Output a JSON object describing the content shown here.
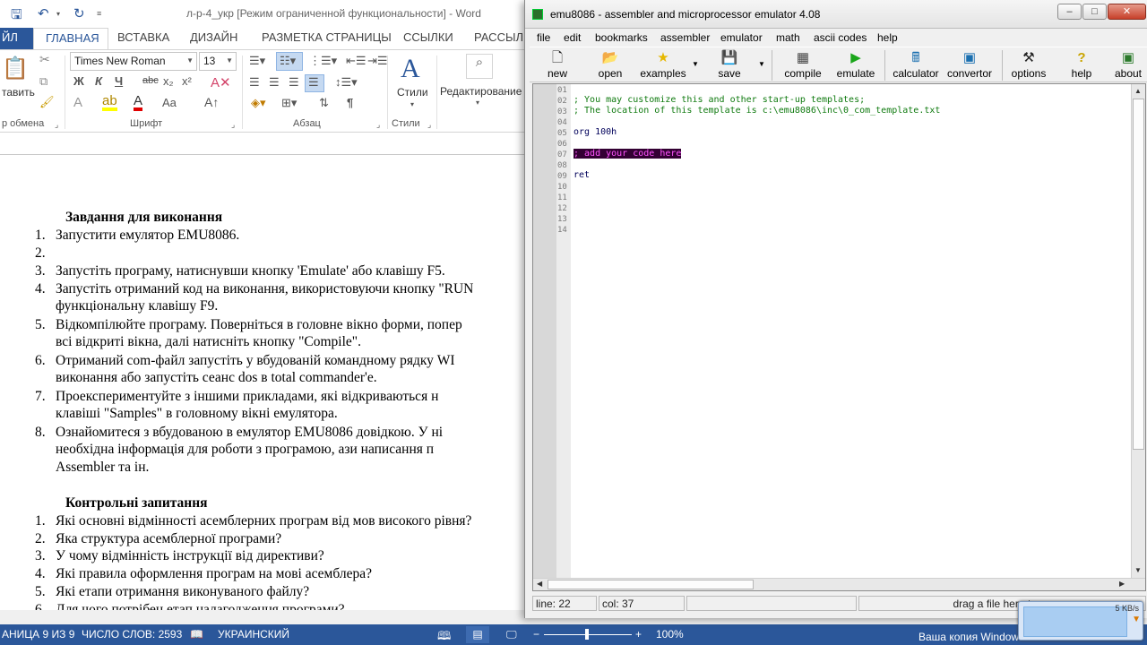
{
  "word": {
    "title": "л-р-4_укр [Режим ограниченной функциональности] - Word",
    "tabs": [
      "ЙЛ",
      "ГЛАВНАЯ",
      "ВСТАВКА",
      "ДИЗАЙН",
      "РАЗМЕТКА СТРАНИЦЫ",
      "ССЫЛКИ",
      "РАССЫЛК"
    ],
    "ribbon": {
      "paste_label": "тавить",
      "clipboard_label": "р обмена",
      "font_name": "Times New Roman",
      "font_size": "13",
      "font_group": "Шрифт",
      "paragraph_group": "Абзац",
      "styles_button": "Стили",
      "styles_group": "Стили",
      "editing_button": "Редактирование",
      "bold": "Ж",
      "italic": "К",
      "underline": "Ч",
      "strike": "abc",
      "subscript": "x₂",
      "superscript": "x²",
      "case": "Aa"
    },
    "doc": {
      "heading1": "Завдання для виконання",
      "tasks": [
        {
          "n": "1.",
          "lines": [
            "Запустити емулятор EMU8086."
          ]
        },
        {
          "n": "2.",
          "lines": [
            ""
          ]
        },
        {
          "n": "3.",
          "lines": [
            "Запустіть програму, натиснувши кнопку 'Emulate' або клавішу F5."
          ]
        },
        {
          "n": "4.",
          "lines": [
            "Запустіть отриманий код на виконання, використовуючи кнопку \"RUN",
            "функціональну клавішу F9."
          ]
        },
        {
          "n": "5.",
          "lines": [
            "Відкомпілюйте програму. Поверніться в головне вікно форми, попер",
            "всі відкриті вікна, далі натисніть кнопку \"Compile\"."
          ]
        },
        {
          "n": "6.",
          "lines": [
            "Отриманий com-файл запустіть у вбудованій командному рядку WI",
            "виконання або запустіть сеанс dos в total commander'е."
          ]
        },
        {
          "n": "7.",
          "lines": [
            "Проекспериментуйте з іншими прикладами, які відкриваються н",
            "клавіші \"Samples\" в головному вікні емулятора."
          ]
        },
        {
          "n": "8.",
          "lines": [
            "Ознайомитеся з вбудованою в емулятор EMU8086 довідкою. У ні",
            "необхідна інформація для роботи з програмою, ази написання п",
            "Assembler та ін."
          ]
        }
      ],
      "heading2": "Контрольні запитання",
      "questions": [
        {
          "n": "1.",
          "text": "Які основні відмінності асемблерних програм від мов високого рівня?"
        },
        {
          "n": "2.",
          "text": "Яка структура асемблерної програми?"
        },
        {
          "n": "3.",
          "text": "У чому відмінність інструкції від директиви?"
        },
        {
          "n": "4.",
          "text": "Які правила оформлення програм на мові асемблера?"
        },
        {
          "n": "5.",
          "text": "Які етапи отримання виконуваного файлу?"
        },
        {
          "n": "6.",
          "text": "Для чого потрібен етап налагодження програми?"
        }
      ]
    },
    "status": {
      "page": "АНИЦА 9 ИЗ 9",
      "words": "ЧИСЛО СЛОВ: 2593",
      "language": "УКРАИНСКИЙ",
      "zoom": "100%"
    }
  },
  "emu": {
    "title": "emu8086 - assembler and microprocessor emulator 4.08",
    "window_buttons": {
      "minimize": "–",
      "maximize": "□",
      "close": "✕"
    },
    "menu": [
      "file",
      "edit",
      "bookmarks",
      "assembler",
      "emulator",
      "math",
      "ascii codes",
      "help"
    ],
    "toolbar": [
      "new",
      "open",
      "examples",
      "save",
      "compile",
      "emulate",
      "calculator",
      "convertor",
      "options",
      "help",
      "about"
    ],
    "line_numbers": [
      "01",
      "02",
      "03",
      "04",
      "05",
      "06",
      "07",
      "08",
      "09",
      "10",
      "11",
      "12",
      "13",
      "14"
    ],
    "code": {
      "line2": "; You may customize this and other start-up templates;",
      "line3": "; The location of this template is c:\\emu8086\\inc\\0_com_template.txt",
      "line5": "org 100h",
      "line7": "; add your code here",
      "line9": "ret"
    },
    "status": {
      "line": "line: 22",
      "col": "col: 37",
      "drag": "drag a file here to op"
    }
  },
  "tray": {
    "watermark": "Ваша копия Windows",
    "net_speed": "5 KB/s"
  }
}
